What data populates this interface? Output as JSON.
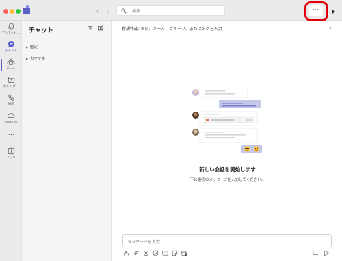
{
  "app": {
    "search_placeholder": "検索",
    "more_label": "···",
    "colors": {
      "accent": "#5b5fc7",
      "highlight_ring": "#e3000b",
      "rail_bg": "#ebebeb",
      "pane_bg": "#f5f5f5"
    }
  },
  "rail": {
    "items": [
      {
        "label": "アクティビ…",
        "icon": "bell-icon"
      },
      {
        "label": "チャット",
        "icon": "chat-icon",
        "active": true
      },
      {
        "label": "チーム",
        "icon": "teams-icon"
      },
      {
        "label": "カレンダー",
        "icon": "calendar-icon"
      },
      {
        "label": "通話",
        "icon": "phone-icon"
      },
      {
        "label": "OneDrive",
        "icon": "cloud-icon"
      },
      {
        "label": "",
        "icon": "more-horizontal-icon"
      },
      {
        "label": "アプリ",
        "icon": "add-apps-icon"
      }
    ]
  },
  "chatpane": {
    "title": "チャット",
    "more_label": "···",
    "sections": [
      {
        "label": "固定",
        "icon": "caret-right-icon"
      },
      {
        "label": "おすすめ",
        "icon": "caret-right-icon"
      }
    ]
  },
  "main": {
    "to_label": "新規作成:",
    "to_placeholder": "名前、メール、グループ、またはタグを入力",
    "empty_title": "新しい会話を開始します",
    "empty_subtitle": "下に最初のメッセージを入力してください。",
    "compose_placeholder": "メッセージを入力"
  }
}
